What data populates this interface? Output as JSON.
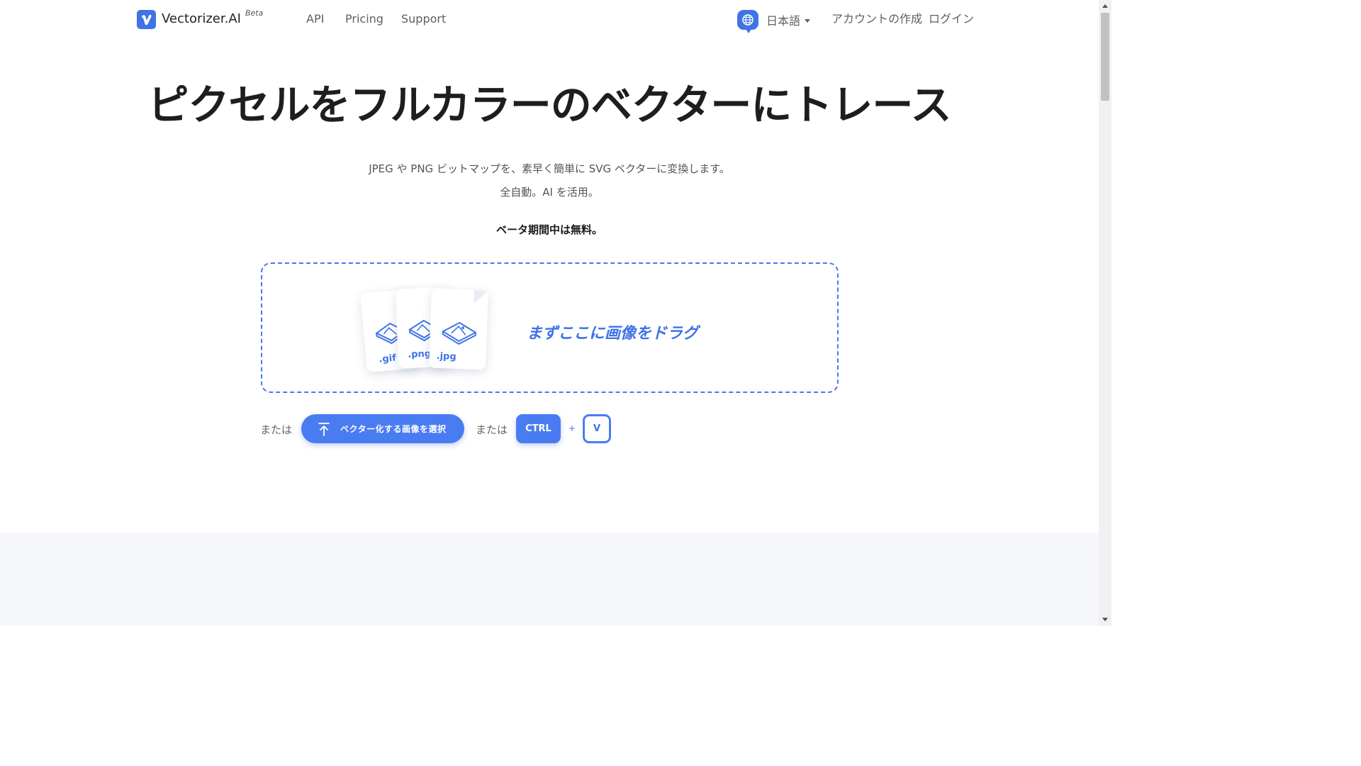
{
  "nav": {
    "brand": "Vectorizer.AI",
    "beta": "Beta",
    "links": [
      "API",
      "Pricing",
      "Support"
    ],
    "language": "日本語",
    "create_account": "アカウントの作成",
    "login": "ログイン"
  },
  "hero": {
    "title": "ピクセルをフルカラーのベクターにトレース",
    "subtitle_1": "JPEG や PNG ビットマップを、素早く簡単に SVG ベクターに変換します。",
    "subtitle_2": "全自動。AI を活用。",
    "free_note": "ベータ期間中は無料。"
  },
  "dropzone": {
    "drag_text": "まずここに画像をドラグ",
    "file_types": [
      ".gif",
      ".png",
      ".jpg"
    ]
  },
  "actions": {
    "or_label": "または",
    "select_button": "ベクター化する画像を選択",
    "key_ctrl": "CTRL",
    "plus": "+",
    "key_v": "V"
  },
  "colors": {
    "accent": "#3f73e6",
    "button": "#4a7cf1",
    "section_bg": "#f6f7fb"
  },
  "icons": [
    "logo-v-icon",
    "globe-icon",
    "caret-down-icon",
    "upload-arrow-icon",
    "image-file-icon"
  ]
}
